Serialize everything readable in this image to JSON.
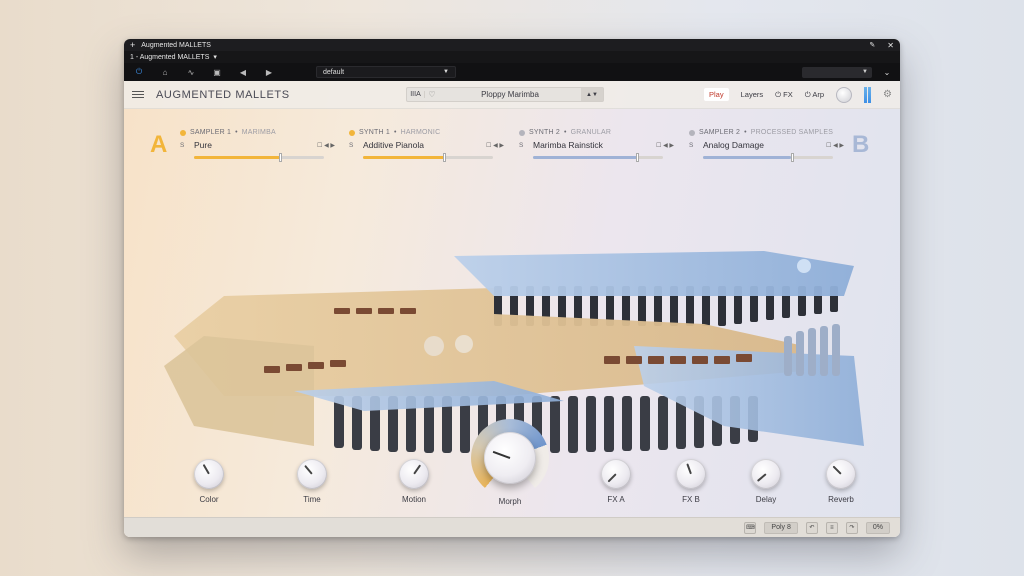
{
  "host": {
    "window_title": "Augmented MALLETS",
    "tab_label": "1 - Augmented MALLETS",
    "preset": "default"
  },
  "plugin": {
    "title": "AUGMENTED MALLETS",
    "preset_name": "Ploppy Marimba",
    "library_label": "IIIA",
    "header_tabs": [
      "Play",
      "Layers",
      "FX",
      "Arp"
    ]
  },
  "layers": {
    "a_label": "A",
    "b_label": "B",
    "slots": [
      {
        "type": "SAMPLER 1",
        "sub": "MARIMBA",
        "name": "Pure",
        "s": "S",
        "level": 0.66,
        "color": "#f2b53a"
      },
      {
        "type": "SYNTH 1",
        "sub": "HARMONIC",
        "name": "Additive Pianola",
        "s": "S",
        "level": 0.62,
        "color": "#f2b53a"
      },
      {
        "type": "SYNTH 2",
        "sub": "GRANULAR",
        "name": "Marimba Rainstick",
        "s": "S",
        "level": 0.8,
        "color": "#9fb2d6"
      },
      {
        "type": "SAMPLER 2",
        "sub": "PROCESSED SAMPLES",
        "name": "Analog Damage",
        "s": "S",
        "level": 0.68,
        "color": "#9fb2d6"
      }
    ]
  },
  "knobs": [
    {
      "label": "Color",
      "angle": -30
    },
    {
      "label": "Time",
      "angle": -40
    },
    {
      "label": "Motion",
      "angle": 35
    },
    {
      "label": "FX A",
      "angle": -135
    },
    {
      "label": "FX B",
      "angle": -20
    },
    {
      "label": "Delay",
      "angle": -130
    },
    {
      "label": "Reverb",
      "angle": -45
    }
  ],
  "morph": {
    "label": "Morph"
  },
  "status": {
    "poly": "Poly 8",
    "cpu": "0%"
  },
  "colors": {
    "accent_a": "#f2b53a",
    "accent_b": "#9fb2d6",
    "active_tab": "#c0392b",
    "power_blue": "#3d8fe6"
  }
}
